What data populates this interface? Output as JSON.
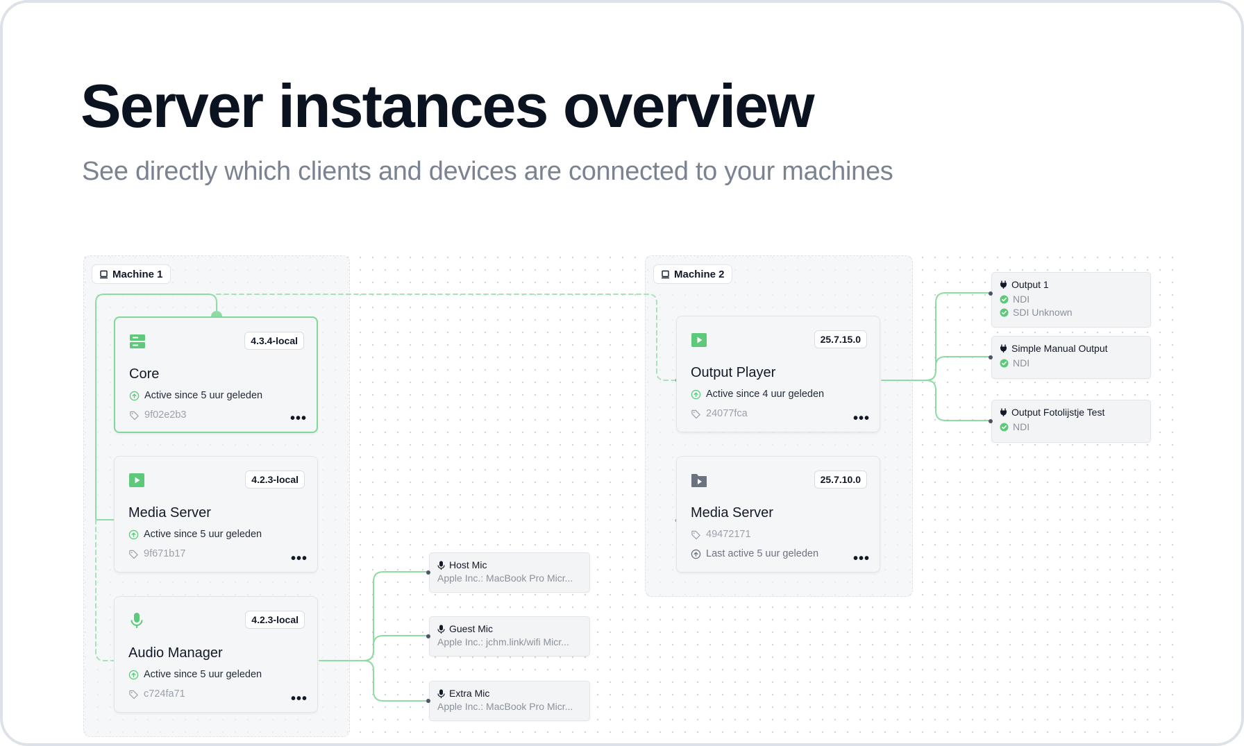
{
  "header": {
    "title": "Server instances overview",
    "subtitle": "See directly which clients and devices are connected to your machines"
  },
  "colors": {
    "accent": "#6fcf87",
    "accent_light": "#aee8bd",
    "text": "#0b1220",
    "muted": "#7b8290"
  },
  "machines": [
    {
      "label": "Machine 1",
      "icon": "laptop-icon"
    },
    {
      "label": "Machine 2",
      "icon": "laptop-icon"
    }
  ],
  "servers": {
    "core": {
      "name": "Core",
      "version": "4.3.4-local",
      "status": "Active since 5 uur geleden",
      "id": "9f02e2b3",
      "icon": "server-icon"
    },
    "media1": {
      "name": "Media Server",
      "version": "4.2.3-local",
      "status": "Active since 5 uur geleden",
      "id": "9f671b17",
      "icon": "play-icon"
    },
    "audio": {
      "name": "Audio Manager",
      "version": "4.2.3-local",
      "status": "Active since 5 uur geleden",
      "id": "c724fa71",
      "icon": "microphone-icon"
    },
    "player": {
      "name": "Output Player",
      "version": "25.7.15.0",
      "status": "Active since 4 uur geleden",
      "id": "24077fca",
      "icon": "play-icon"
    },
    "media2": {
      "name": "Media Server",
      "version": "25.7.10.0",
      "id": "49472171",
      "last_active": "Last active 5 uur geleden",
      "icon": "folder-play-icon"
    }
  },
  "mics": [
    {
      "name": "Host Mic",
      "device": "Apple Inc.: MacBook Pro Micr..."
    },
    {
      "name": "Guest Mic",
      "device": "Apple Inc.: jchm.link/wifi Micr..."
    },
    {
      "name": "Extra Mic",
      "device": "Apple Inc.: MacBook Pro Micr..."
    }
  ],
  "outputs": [
    {
      "name": "Output 1",
      "signals": [
        "NDI",
        "SDI Unknown"
      ]
    },
    {
      "name": "Simple Manual Output",
      "signals": [
        "NDI"
      ]
    },
    {
      "name": "Output Fotolijstje Test",
      "signals": [
        "NDI"
      ]
    }
  ],
  "more_label": "•••"
}
